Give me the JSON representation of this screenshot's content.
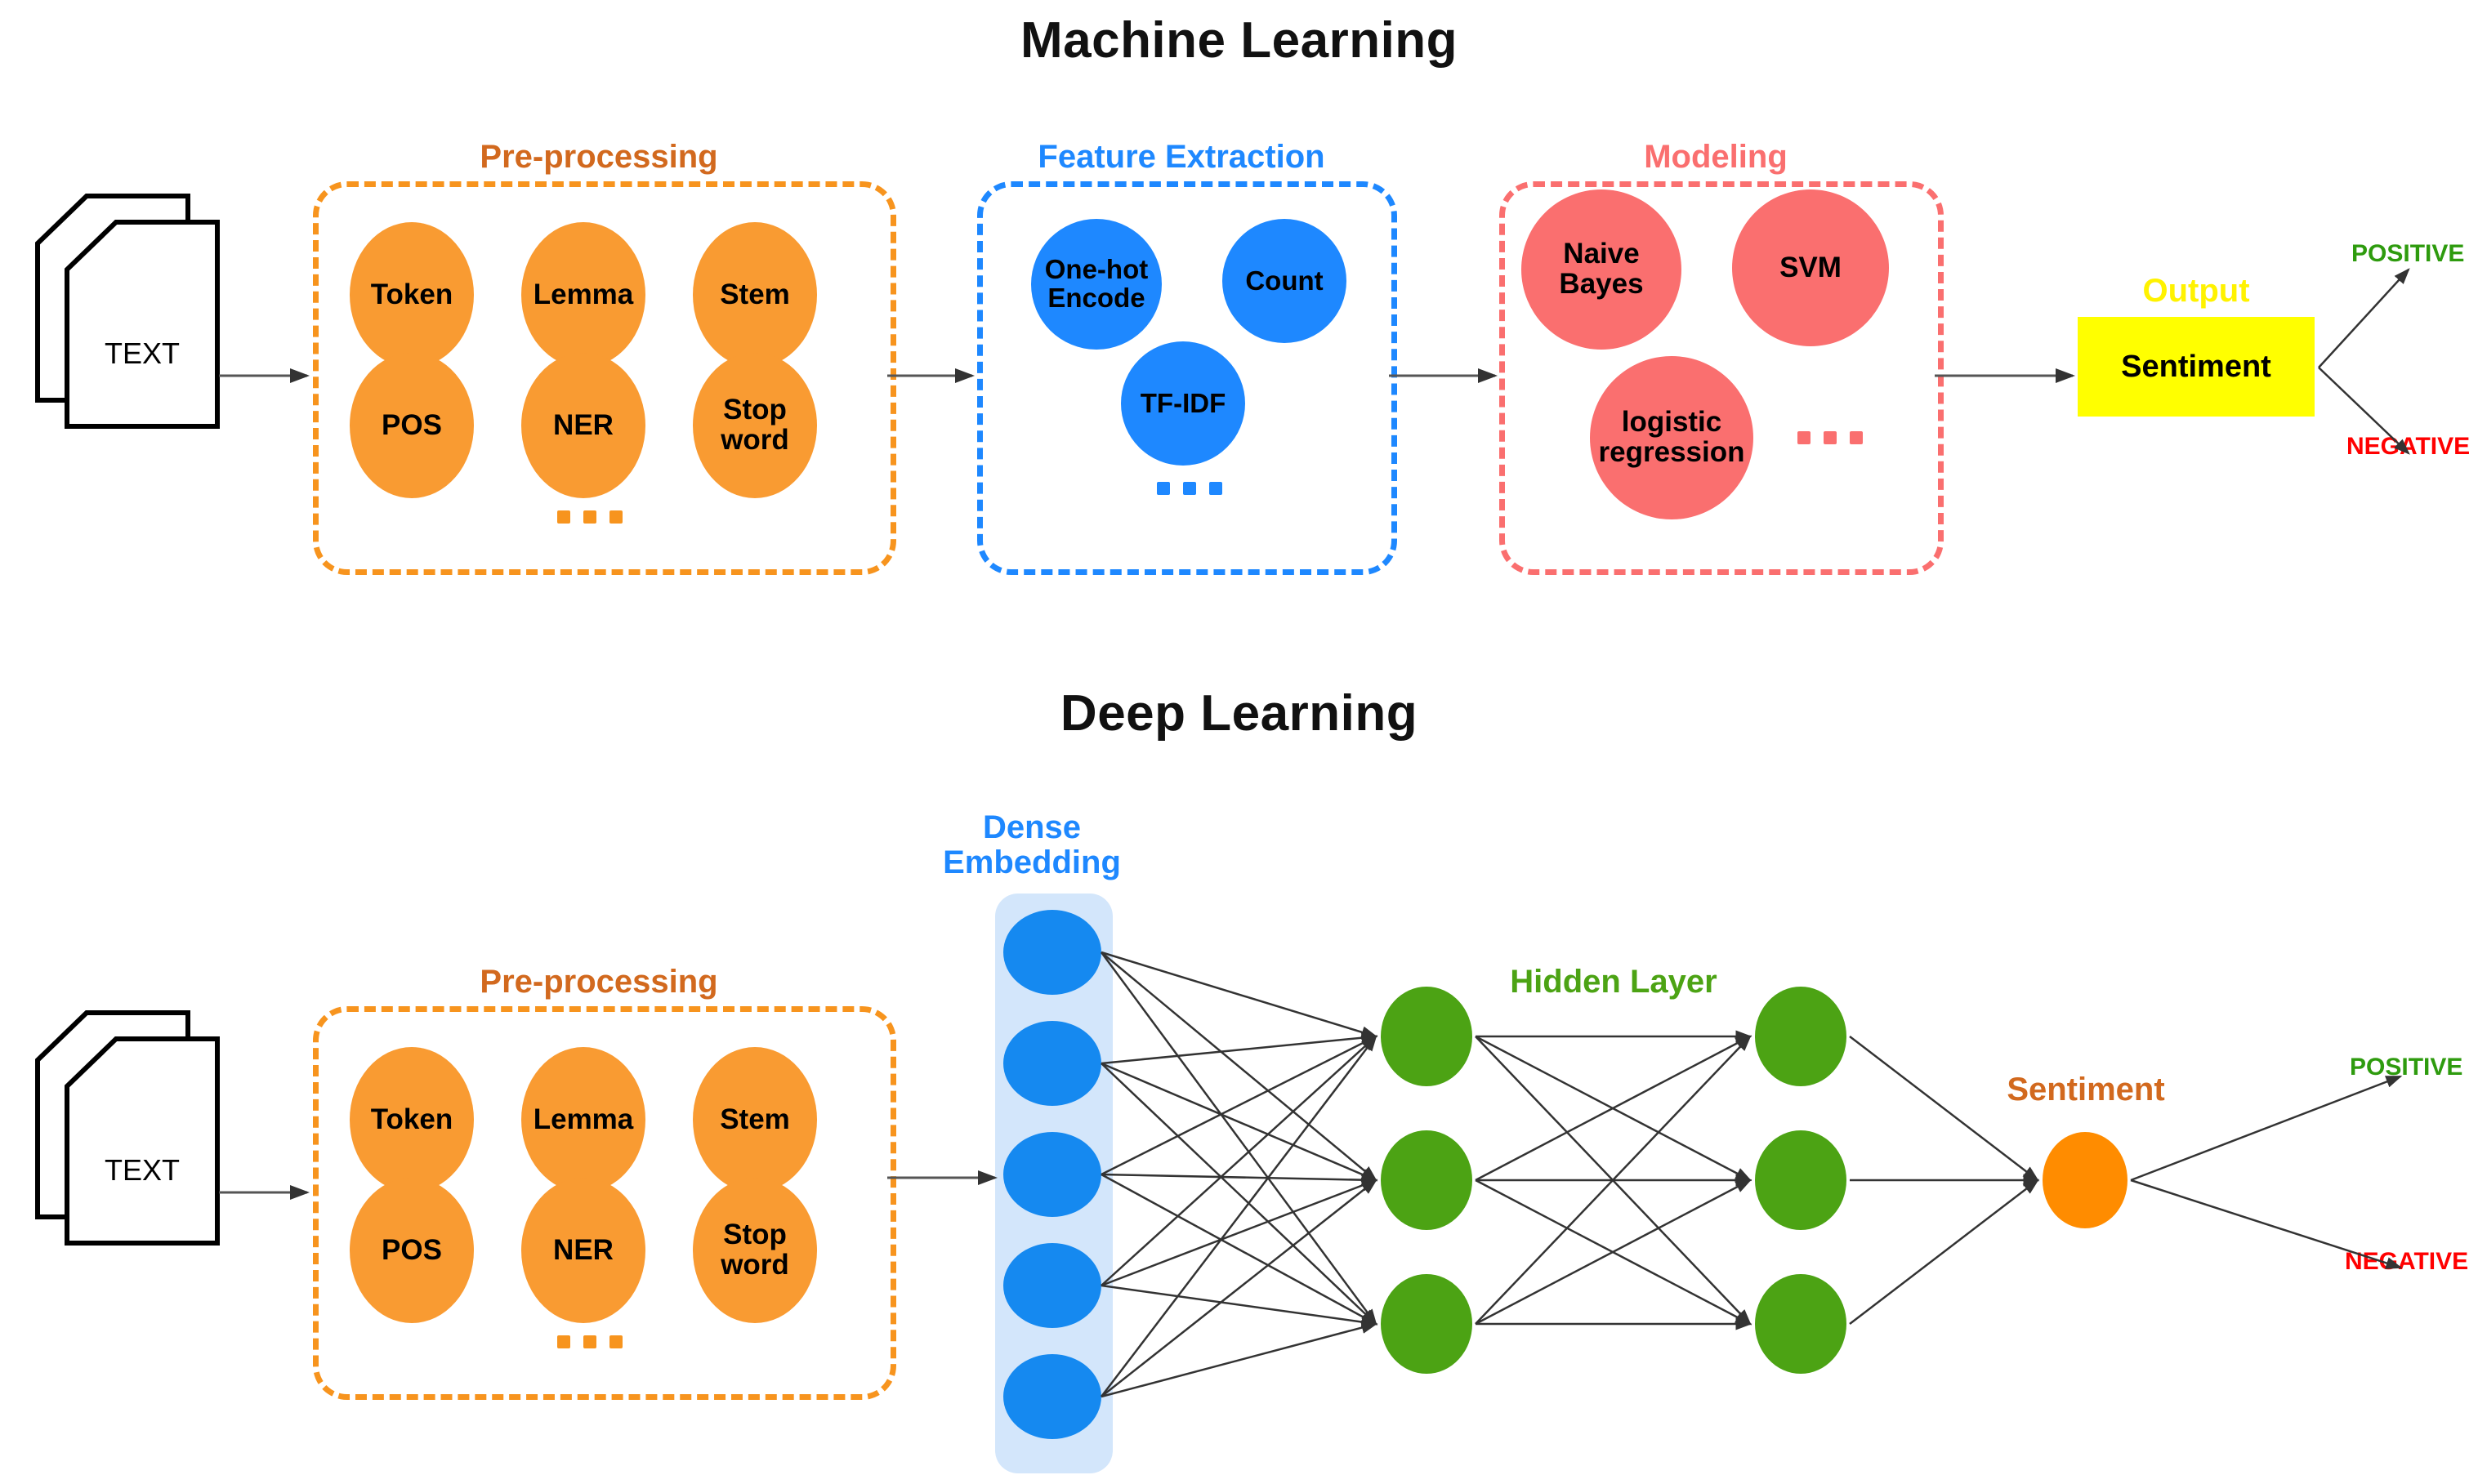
{
  "sections": [
    {
      "id": "ml",
      "title": "Machine Learning"
    },
    {
      "id": "dl",
      "title": "Deep Learning"
    }
  ],
  "colors": {
    "orange": "#F99B32",
    "orange_border": "#F7941E",
    "orange_label": "#D2691E",
    "blue": "#1E88FF",
    "blue_node": "#1589F0",
    "blue_panel": "#D3E6FB",
    "red": "#FA6F6F",
    "green": "#4CA314",
    "yellow": "#FFFF00",
    "yellow_label": "#FFF200",
    "sentiment_node": "#FF8C00",
    "positive": "#2E9B0E",
    "negative": "#FF0000",
    "text_black": "#000000"
  },
  "ml": {
    "input": {
      "label": "TEXT",
      "icon": "document-stack-icon"
    },
    "preprocessing": {
      "label": "Pre-processing",
      "nodes": [
        {
          "label": "Token"
        },
        {
          "label": "Lemma"
        },
        {
          "label": "Stem"
        },
        {
          "label": "POS"
        },
        {
          "label": "NER"
        },
        {
          "label": "Stop word"
        }
      ],
      "ellipsis": "..."
    },
    "feature_extraction": {
      "label": "Feature Extraction",
      "nodes": [
        {
          "label": "One-hot Encode"
        },
        {
          "label": "Count"
        },
        {
          "label": "TF-IDF"
        }
      ],
      "ellipsis": "..."
    },
    "modeling": {
      "label": "Modeling",
      "nodes": [
        {
          "label": "Naive Bayes"
        },
        {
          "label": "SVM"
        },
        {
          "label": "logistic regression"
        }
      ],
      "ellipsis": "..."
    },
    "output": {
      "label": "Output",
      "box_label": "Sentiment",
      "positive": "POSITIVE",
      "negative": "NEGATIVE"
    }
  },
  "dl": {
    "input": {
      "label": "TEXT",
      "icon": "document-stack-icon"
    },
    "preprocessing": {
      "label": "Pre-processing",
      "nodes": [
        {
          "label": "Token"
        },
        {
          "label": "Lemma"
        },
        {
          "label": "Stem"
        },
        {
          "label": "POS"
        },
        {
          "label": "NER"
        },
        {
          "label": "Stop word"
        }
      ],
      "ellipsis": "..."
    },
    "dense_embedding": {
      "label_line1": "Dense",
      "label_line2": "Embedding",
      "node_count": 5
    },
    "hidden_layer": {
      "label": "Hidden Layer",
      "layer1_count": 3,
      "layer2_count": 3
    },
    "output": {
      "label": "Sentiment",
      "positive": "POSITIVE",
      "negative": "NEGATIVE"
    }
  }
}
